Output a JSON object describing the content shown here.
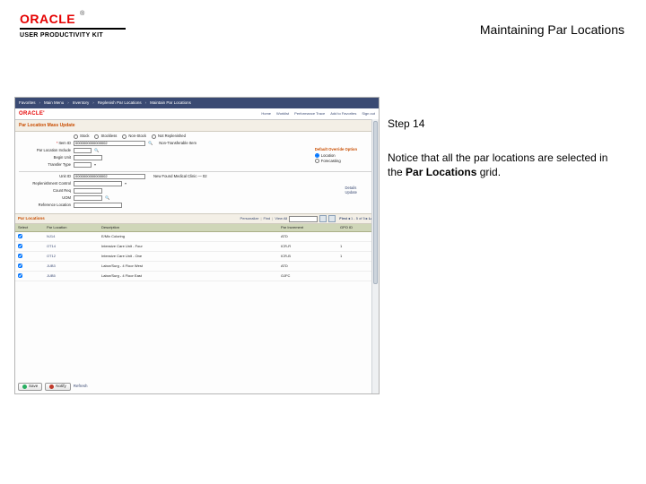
{
  "header": {
    "brand_word": "ORACLE",
    "brand_kit": "USER PRODUCTIVITY KIT",
    "page_title": "Maintaining Par Locations"
  },
  "instruction": {
    "step": "Step 14",
    "line1": "Notice that all the par locations are selected in the ",
    "bold": "Par Locations",
    "line2": " grid."
  },
  "breadcrumb": {
    "items": [
      "Favorites",
      "Main Menu",
      "Inventory",
      "Replenish Par Locations",
      "Maintain Par Locations"
    ]
  },
  "obar": {
    "brand": "ORACLE'",
    "links": [
      "Home",
      "Worklist",
      "Performance Trace",
      "Add to Favorites",
      "Sign out"
    ]
  },
  "sub_header": "Par Location Mass Update",
  "form": {
    "mode": {
      "label": "",
      "opts": [
        "Stock",
        "Stockless",
        "Non-Stock",
        "Not Replenished"
      ]
    },
    "item_id": {
      "label": "Item ID",
      "value": "0000000000000002",
      "hint": "Non-Transferable Item"
    },
    "par_loc_include": {
      "label": "Par Location Include",
      "value": ""
    },
    "begin_unit": {
      "label": "Begin Unit",
      "value": ""
    },
    "transfer_type": {
      "label": "Transfer Type",
      "value": ""
    },
    "default_options": {
      "title": "Default Override Option",
      "opts": [
        "Location",
        "Forecasting"
      ]
    },
    "unit_id": {
      "label": "Unit ID",
      "value": "0000000000000002",
      "hint": "New Found Medical Clinic — 02"
    },
    "replenish_control": {
      "label": "Replenishment Control",
      "value": ""
    },
    "count_req": {
      "label": "Count Req",
      "value": ""
    },
    "uom": {
      "label": "UOM",
      "value": ""
    },
    "ref_loc": {
      "label": "Reference Location",
      "value": ""
    },
    "action_items": {
      "items": [
        "Details",
        "Update"
      ]
    }
  },
  "grid": {
    "title": "Par Locations",
    "controls": {
      "personalize": "Personalize",
      "find": "Find",
      "viewall": "View All",
      "find_value": ""
    },
    "nav": {
      "first": "First",
      "range": "1 - 5 of 5",
      "last": "Last"
    },
    "columns": [
      "Select",
      "Par Location",
      "Description",
      "Par Increment",
      "GPO ID"
    ],
    "rows": [
      {
        "sel": true,
        "loc": "NJ14",
        "desc": "E/Mix Coloring",
        "inc": "ATD",
        "gpo": ""
      },
      {
        "sel": true,
        "loc": "OT14",
        "desc": "Intensive Care Unit - Four",
        "inc": "ICR-R",
        "gpo": "1"
      },
      {
        "sel": true,
        "loc": "OT12",
        "desc": "Intensive Care Unit - One",
        "inc": "ICR-B",
        "gpo": "1"
      },
      {
        "sel": true,
        "loc": "JUB3",
        "desc": "Labor/Surg - 4 Floor West",
        "inc": "ATD",
        "gpo": ""
      },
      {
        "sel": true,
        "loc": "JUB5",
        "desc": "Labor/Surg - 4 Floor East",
        "inc": "OJFC",
        "gpo": ""
      }
    ]
  },
  "footer": {
    "save": "Save",
    "notify": "Notify",
    "refresh": "Refresh"
  }
}
